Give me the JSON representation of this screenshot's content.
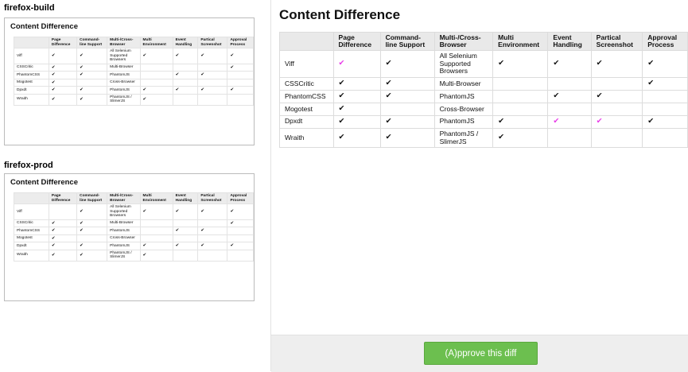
{
  "panes": [
    {
      "env": "firefox-build",
      "heading": "Content Difference"
    },
    {
      "env": "firefox-prod",
      "heading": "Content Difference"
    }
  ],
  "table": {
    "headers": [
      "",
      "Page Difference",
      "Command-line Support",
      "Multi-/Cross-Browser",
      "Multi Environment",
      "Event Handling",
      "Partical Screenshot",
      "Approval Process"
    ],
    "rows": [
      {
        "name": "Viff",
        "cells": [
          "check",
          "check",
          "All Selenium Supported Browsers",
          "check",
          "check",
          "check",
          "check"
        ]
      },
      {
        "name": "CSSCritic",
        "cells": [
          "check",
          "check",
          "Multi-Browser",
          "",
          "",
          "",
          "check"
        ]
      },
      {
        "name": "PhantomCSS",
        "cells": [
          "check",
          "check",
          "PhantomJS",
          "",
          "check",
          "check",
          ""
        ]
      },
      {
        "name": "Mogotest",
        "cells": [
          "check",
          "",
          "Cross-Browser",
          "",
          "",
          "",
          ""
        ]
      },
      {
        "name": "Dpxdt",
        "cells": [
          "check",
          "check",
          "PhantomJS",
          "check",
          "check",
          "check",
          "check"
        ]
      },
      {
        "name": "Wraith",
        "cells": [
          "check",
          "check",
          "PhantomJS / SlimerJS",
          "check",
          "",
          "",
          ""
        ]
      }
    ]
  },
  "differences": {
    "build_only": [
      "Viff|Page Difference"
    ],
    "diff_highlight_rows": [
      {
        "row": 0,
        "col": 0
      },
      {
        "row": 4,
        "col": 4
      },
      {
        "row": 4,
        "col": 5
      }
    ]
  },
  "check_glyph": "✔",
  "colors": {
    "approve_bg": "#6cbf4f",
    "diff_check": "#e83be8",
    "footer_bg": "#eeeeee"
  },
  "diff_panel": {
    "heading": "Content Difference"
  },
  "approve_button": {
    "label": "(A)pprove this diff"
  }
}
